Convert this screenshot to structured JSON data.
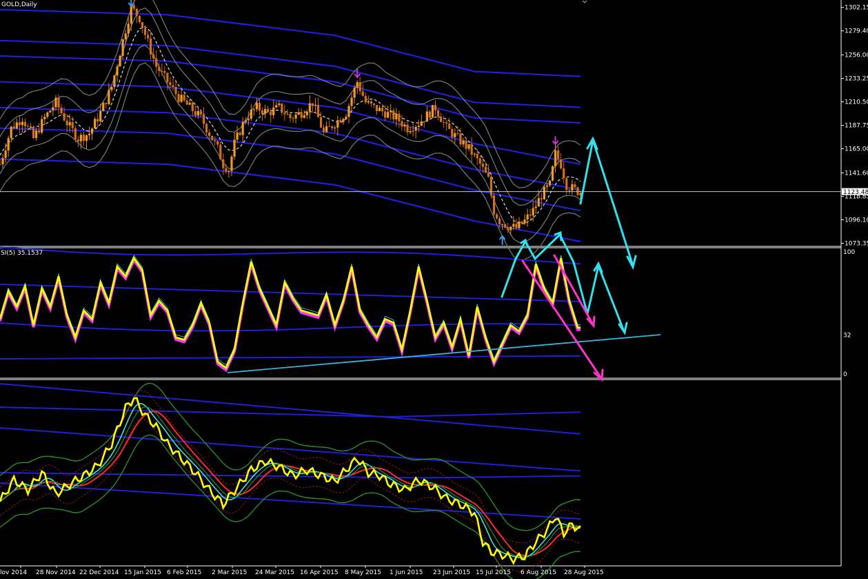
{
  "window": {
    "title": "GOLD,Daily",
    "rsi_label": "SI(5) 35.1537",
    "current_price": "1123.48"
  },
  "colors": {
    "background": "#000000",
    "bull_candle": "#e8891c",
    "bear_candle": "#e8891c",
    "envelope": "#1f1fd6",
    "bollinger": "#6f7f7f",
    "rsi_main": "#ffff00",
    "rsi_shadow": "#ff33ff",
    "arrow_cyan": "#33e0ee",
    "arrow_magenta": "#ff33cc",
    "trendline": "#3ab0e0",
    "ma_red": "#ff2a2a",
    "ma_cyan": "#40e0e0",
    "ma_green": "#2e8b2e"
  },
  "chart_data": [
    {
      "type": "candlestick",
      "title": "GOLD,Daily",
      "price_axis_labels": [
        "1302.15",
        "1279.40",
        "1256.00",
        "1233.25",
        "1210.50",
        "1187.75",
        "1165.00",
        "1141.60",
        "1118.85",
        "1096.10",
        "1073.35"
      ],
      "price_axis_values": [
        1302.15,
        1279.4,
        1256.0,
        1233.25,
        1210.5,
        1187.75,
        1165.0,
        1141.6,
        1118.85,
        1096.1,
        1073.35
      ],
      "ylim": [
        1071.0,
        1308.0
      ],
      "current_price": 1123.48,
      "x_labels": [
        "lov 2014",
        "28 Nov 2014",
        "22 Dec 2014",
        "15 Jan 2015",
        "6 Feb 2015",
        "2 Mar 2015",
        "24 Mar 2015",
        "16 Apr 2015",
        "8 May 2015",
        "1 Jun 2015",
        "23 Jun 2015",
        "15 Jul 2015",
        "6 Aug 2015",
        "28 Aug 2015"
      ],
      "close_path": [
        [
          0,
          1150
        ],
        [
          4,
          1185
        ],
        [
          8,
          1195
        ],
        [
          12,
          1175
        ],
        [
          16,
          1195
        ],
        [
          20,
          1210
        ],
        [
          24,
          1190
        ],
        [
          28,
          1175
        ],
        [
          32,
          1180
        ],
        [
          36,
          1200
        ],
        [
          40,
          1225
        ],
        [
          44,
          1270
        ],
        [
          47,
          1302
        ],
        [
          50,
          1292
        ],
        [
          53,
          1268
        ],
        [
          56,
          1245
        ],
        [
          60,
          1230
        ],
        [
          64,
          1215
        ],
        [
          68,
          1205
        ],
        [
          72,
          1195
        ],
        [
          76,
          1175
        ],
        [
          78,
          1165
        ],
        [
          80,
          1150
        ],
        [
          82,
          1145
        ],
        [
          84,
          1170
        ],
        [
          88,
          1195
        ],
        [
          92,
          1205
        ],
        [
          96,
          1200
        ],
        [
          100,
          1205
        ],
        [
          104,
          1195
        ],
        [
          108,
          1200
        ],
        [
          112,
          1210
        ],
        [
          116,
          1180
        ],
        [
          120,
          1190
        ],
        [
          124,
          1200
        ],
        [
          126,
          1215
        ],
        [
          128,
          1230
        ],
        [
          131,
          1210
        ],
        [
          134,
          1205
        ],
        [
          138,
          1200
        ],
        [
          142,
          1195
        ],
        [
          146,
          1185
        ],
        [
          150,
          1190
        ],
        [
          154,
          1200
        ],
        [
          156,
          1205
        ],
        [
          160,
          1185
        ],
        [
          164,
          1175
        ],
        [
          168,
          1165
        ],
        [
          172,
          1150
        ],
        [
          175,
          1135
        ],
        [
          177,
          1105
        ],
        [
          179,
          1095
        ],
        [
          182,
          1090
        ],
        [
          185,
          1088
        ],
        [
          188,
          1095
        ],
        [
          191,
          1105
        ],
        [
          194,
          1120
        ],
        [
          197,
          1130
        ],
        [
          199,
          1160
        ],
        [
          201,
          1150
        ],
        [
          203,
          1130
        ],
        [
          206,
          1125
        ],
        [
          208,
          1123
        ]
      ],
      "markers": [
        {
          "type": "down-arrow",
          "color": "#3a9ae8",
          "at": 47,
          "price": 1302
        },
        {
          "type": "down-arrow",
          "color": "#cc33cc",
          "at": 128,
          "price": 1233
        },
        {
          "type": "down-arrow",
          "color": "#cc33cc",
          "at": 199,
          "price": 1168
        },
        {
          "type": "up-arrow",
          "color": "#3a9ae8",
          "at": 180,
          "price": 1073
        }
      ]
    },
    {
      "type": "line",
      "title": "SI(5) 35.1537",
      "ylim": [
        0,
        100
      ],
      "axis_labels": [
        "100",
        "32",
        "0"
      ],
      "axis_values": [
        100,
        32,
        0
      ],
      "series": [
        {
          "values": [
            [
              0,
              45
            ],
            [
              3,
              68
            ],
            [
              6,
              55
            ],
            [
              9,
              72
            ],
            [
              12,
              40
            ],
            [
              15,
              70
            ],
            [
              18,
              55
            ],
            [
              21,
              80
            ],
            [
              24,
              48
            ],
            [
              27,
              30
            ],
            [
              30,
              52
            ],
            [
              33,
              45
            ],
            [
              36,
              75
            ],
            [
              39,
              58
            ],
            [
              42,
              88
            ],
            [
              45,
              80
            ],
            [
              48,
              95
            ],
            [
              51,
              85
            ],
            [
              54,
              48
            ],
            [
              57,
              60
            ],
            [
              60,
              52
            ],
            [
              63,
              30
            ],
            [
              66,
              28
            ],
            [
              69,
              40
            ],
            [
              72,
              58
            ],
            [
              75,
              42
            ],
            [
              78,
              10
            ],
            [
              81,
              5
            ],
            [
              84,
              20
            ],
            [
              87,
              58
            ],
            [
              90,
              92
            ],
            [
              93,
              70
            ],
            [
              96,
              55
            ],
            [
              99,
              40
            ],
            [
              102,
              75
            ],
            [
              105,
              62
            ],
            [
              108,
              52
            ],
            [
              111,
              50
            ],
            [
              114,
              48
            ],
            [
              117,
              65
            ],
            [
              120,
              40
            ],
            [
              123,
              60
            ],
            [
              126,
              88
            ],
            [
              129,
              52
            ],
            [
              132,
              40
            ],
            [
              135,
              30
            ],
            [
              138,
              45
            ],
            [
              141,
              42
            ],
            [
              144,
              20
            ],
            [
              147,
              52
            ],
            [
              150,
              88
            ],
            [
              153,
              60
            ],
            [
              156,
              30
            ],
            [
              159,
              42
            ],
            [
              162,
              22
            ],
            [
              165,
              45
            ],
            [
              168,
              15
            ],
            [
              171,
              55
            ],
            [
              174,
              30
            ],
            [
              177,
              10
            ],
            [
              180,
              25
            ],
            [
              183,
              40
            ],
            [
              186,
              35
            ],
            [
              189,
              48
            ],
            [
              192,
              90
            ],
            [
              195,
              70
            ],
            [
              198,
              58
            ],
            [
              201,
              95
            ],
            [
              204,
              60
            ],
            [
              207,
              38
            ]
          ]
        }
      ]
    },
    {
      "type": "line",
      "title": "",
      "series": [
        {
          "values": [
            [
              0,
              40
            ],
            [
              5,
              55
            ],
            [
              10,
              48
            ],
            [
              15,
              60
            ],
            [
              20,
              45
            ],
            [
              25,
              52
            ],
            [
              30,
              58
            ],
            [
              35,
              65
            ],
            [
              40,
              80
            ],
            [
              45,
              105
            ],
            [
              48,
              112
            ],
            [
              52,
              100
            ],
            [
              56,
              92
            ],
            [
              60,
              80
            ],
            [
              65,
              70
            ],
            [
              70,
              60
            ],
            [
              75,
              48
            ],
            [
              80,
              38
            ],
            [
              85,
              50
            ],
            [
              90,
              62
            ],
            [
              95,
              68
            ],
            [
              100,
              64
            ],
            [
              105,
              58
            ],
            [
              110,
              62
            ],
            [
              115,
              58
            ],
            [
              120,
              54
            ],
            [
              125,
              64
            ],
            [
              128,
              70
            ],
            [
              132,
              60
            ],
            [
              136,
              58
            ],
            [
              140,
              52
            ],
            [
              145,
              48
            ],
            [
              150,
              55
            ],
            [
              155,
              50
            ],
            [
              160,
              42
            ],
            [
              165,
              38
            ],
            [
              170,
              32
            ],
            [
              173,
              12
            ],
            [
              176,
              5
            ],
            [
              180,
              3
            ],
            [
              184,
              0
            ],
            [
              188,
              2
            ],
            [
              192,
              12
            ],
            [
              196,
              20
            ],
            [
              199,
              30
            ],
            [
              202,
              18
            ],
            [
              205,
              24
            ],
            [
              208,
              20
            ]
          ]
        }
      ]
    }
  ]
}
